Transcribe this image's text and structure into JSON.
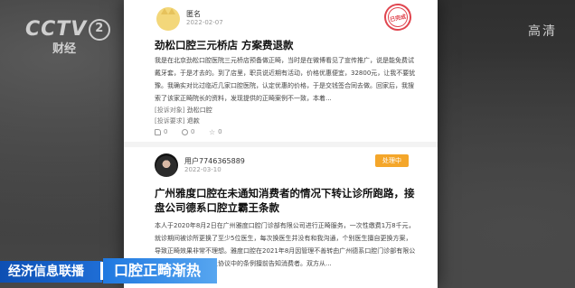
{
  "post1": {
    "username": "匿名",
    "date": "2022-02-07",
    "stamp": "已完成",
    "title": "劲松口腔三元桥店 方案费退款",
    "body": "我是在北京劲松口腔医院三元桥店预备做正畸，当时是在微博看见了宣传推广，说是能免费试戴牙套，于是才去的。到了店里，职员说近期有活动，价格优惠便宜，32800元，让我不要犹豫。我确实对比过临近几家口腔医院，认定优惠的价格，于是交钱签合同去做。回家后，我搜索了该家正畸院长的资料，发现提供的正畸案例不一致，本着...",
    "object_label": "[投诉对象]",
    "object_value": "劲松口腔",
    "demand_label": "[投诉要求]",
    "demand_value": "退款",
    "likes": "0",
    "comments": "0",
    "favorites": "0"
  },
  "post2": {
    "username": "用户7746365889",
    "date": "2022-03-10",
    "status": "处理中",
    "title": "广州雅度口腔在未通知消费者的情况下转让诊所跑路，接盘公司德系口腔立霸王条款",
    "body": "本人于2020年8月2日在广州雅度口腔门诊部有限公司进行正畸服务，一次性缴费1万8千元，就诊期间被诊所更换了至少5位医生，每次换医生并没有和我沟通，个别医生擅自更换方案，导致正畸效果非常不理想。雅度口腔在2021年8月因管理不善转由广州德系口腔门诊部有限公司接诊，却未履行转让协议中的条例擅前告知消费者。双方从..."
  },
  "overlay": {
    "channel_logo": "CCTV",
    "channel_num": "2",
    "channel_sub": "财经",
    "hd_label": "高清",
    "program": "经济信息联播",
    "topic": "口腔正畸渐热"
  }
}
